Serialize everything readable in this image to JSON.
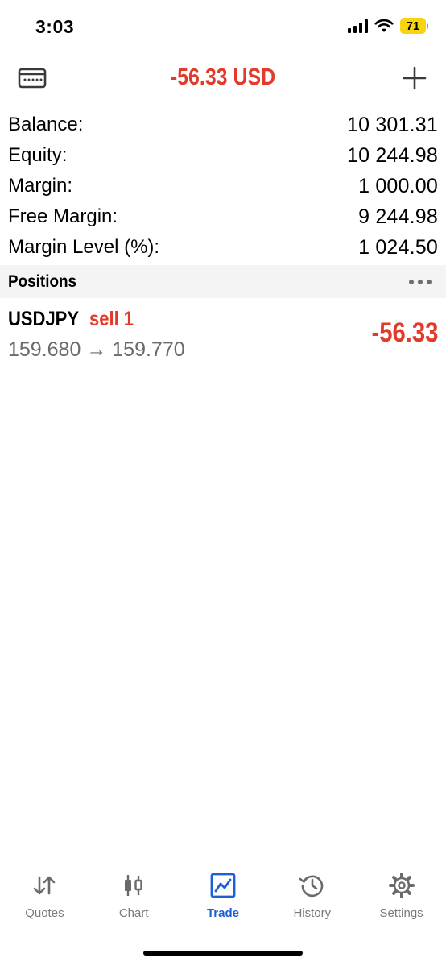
{
  "status_bar": {
    "time": "3:03",
    "battery": "71",
    "icons": [
      "signal-icon",
      "wifi-icon",
      "battery-icon"
    ]
  },
  "header": {
    "title": "-56.33 USD",
    "left_icon": "account-card-icon",
    "right_icon": "add-icon",
    "title_color": "#e23b2c"
  },
  "summary": [
    {
      "label": "Balance:",
      "value": "10 301.31"
    },
    {
      "label": "Equity:",
      "value": "10 244.98"
    },
    {
      "label": "Margin:",
      "value": "1 000.00"
    },
    {
      "label": "Free Margin:",
      "value": "9 244.98"
    },
    {
      "label": "Margin Level (%):",
      "value": "1 024.50"
    }
  ],
  "positions": {
    "title": "Positions",
    "more_icon": "more-icon",
    "items": [
      {
        "symbol": "USDJPY",
        "type": "sell 1",
        "prices": "159.680 → 159.770",
        "profit": "-56.33"
      }
    ]
  },
  "tabs": [
    {
      "label": "Quotes",
      "icon": "quotes-icon",
      "active": false
    },
    {
      "label": "Chart",
      "icon": "chart-icon",
      "active": false
    },
    {
      "label": "Trade",
      "icon": "trade-icon",
      "active": true
    },
    {
      "label": "History",
      "icon": "history-icon",
      "active": false
    },
    {
      "label": "Settings",
      "icon": "settings-icon",
      "active": false
    }
  ],
  "colors": {
    "loss": "#e23b2c",
    "active_tab": "#1f5fd6",
    "inactive_tab": "#7a7a7a",
    "battery": "#f7d40f"
  }
}
